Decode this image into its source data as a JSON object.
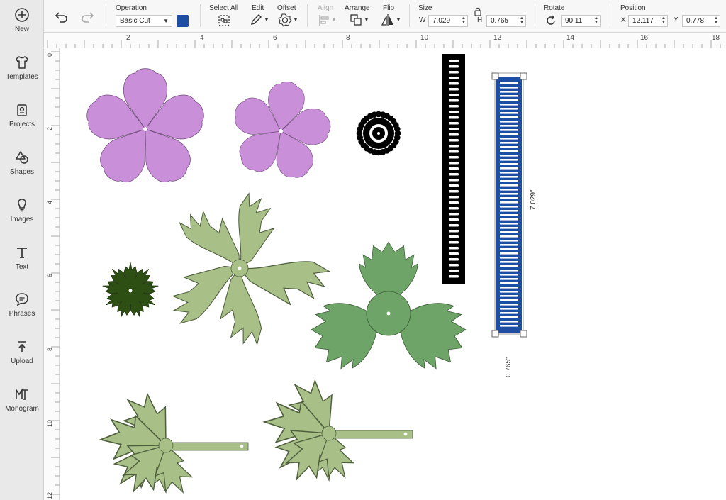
{
  "sidebar": {
    "items": [
      {
        "label": "New",
        "icon": "plus-circle-icon"
      },
      {
        "label": "Templates",
        "icon": "shirt-icon"
      },
      {
        "label": "Projects",
        "icon": "projects-icon"
      },
      {
        "label": "Shapes",
        "icon": "shapes-icon"
      },
      {
        "label": "Images",
        "icon": "lightbulb-icon"
      },
      {
        "label": "Text",
        "icon": "text-icon"
      },
      {
        "label": "Phrases",
        "icon": "speech-bubble-icon"
      },
      {
        "label": "Upload",
        "icon": "upload-icon"
      },
      {
        "label": "Monogram",
        "icon": "monogram-icon"
      }
    ]
  },
  "toolbar": {
    "operation_label": "Operation",
    "operation_value": "Basic Cut",
    "operation_color": "#1c4fa3",
    "select_all_label": "Select All",
    "edit_label": "Edit",
    "offset_label": "Offset",
    "align_label": "Align",
    "arrange_label": "Arrange",
    "flip_label": "Flip",
    "size_label": "Size",
    "size_w_label": "W",
    "size_w_value": "7.029",
    "size_h_label": "H",
    "size_h_value": "0.765",
    "rotate_label": "Rotate",
    "rotate_value": "90.11",
    "position_label": "Position",
    "position_x_label": "X",
    "position_x_value": "12.117",
    "position_y_label": "Y",
    "position_y_value": "0.778"
  },
  "ruler": {
    "top_numbers": [
      "2",
      "4",
      "6",
      "8",
      "10",
      "12",
      "14",
      "16",
      "18"
    ],
    "left_numbers": [
      "0",
      "2",
      "4",
      "6",
      "8",
      "10",
      "12"
    ]
  },
  "canvas": {
    "selection_height_label": "7.029\"",
    "selection_width_label": "0.765\"",
    "colors": {
      "flower_purple": "#c98fd8",
      "leaf_light": "#a8c088",
      "leaf_mid": "#6ea468",
      "leaf_dark": "#2d4f14",
      "selected_blue": "#1c4fa3",
      "black": "#000000"
    }
  }
}
